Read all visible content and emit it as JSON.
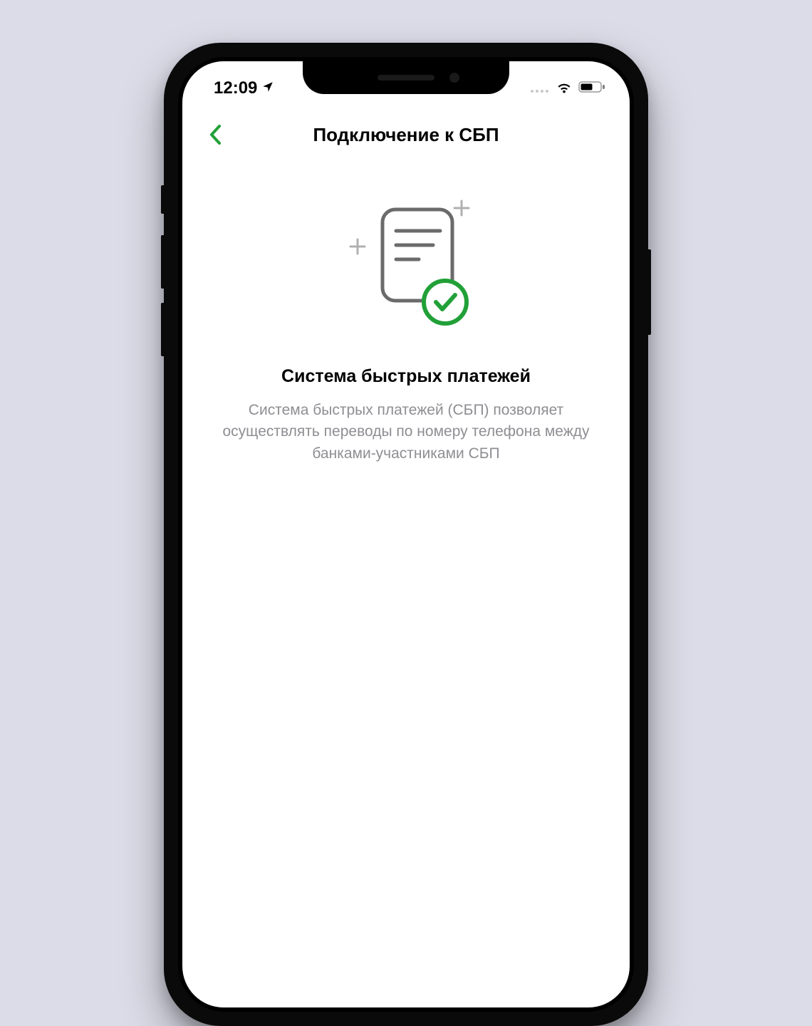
{
  "status_bar": {
    "time": "12:09"
  },
  "header": {
    "title": "Подключение к СБП"
  },
  "content": {
    "heading": "Система быстрых платежей",
    "description": "Система быстрых платежей (СБП) позволяет осуществлять переводы по номеру телефона между банками-участниками СБП"
  },
  "colors": {
    "accent": "#21A038",
    "background": "#DCDCE8",
    "text_secondary": "#8E8E93"
  }
}
